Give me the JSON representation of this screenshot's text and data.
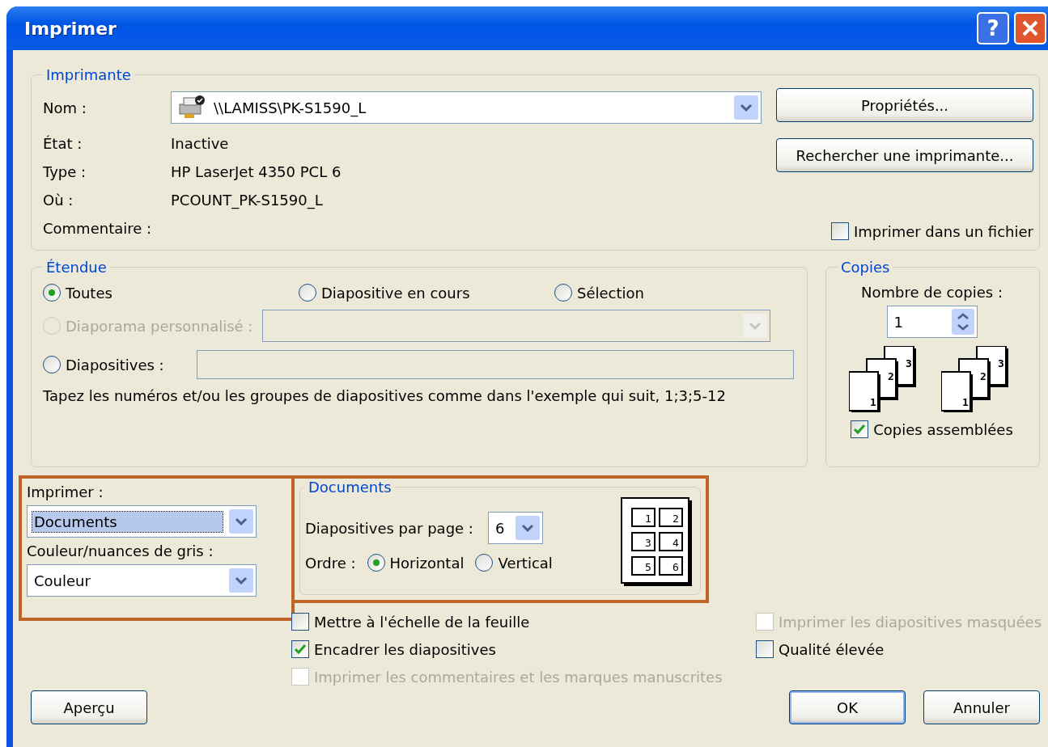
{
  "window": {
    "title": "Imprimer",
    "help_label": "?"
  },
  "printer": {
    "legend": "Imprimante",
    "name_label": "Nom :",
    "name_value": "\\\\LAMISS\\PK-S1590_L",
    "info": [
      {
        "label": "État :",
        "value": "Inactive"
      },
      {
        "label": "Type :",
        "value": "HP LaserJet 4350 PCL 6"
      },
      {
        "label": "Où :",
        "value": "PCOUNT_PK-S1590_L"
      },
      {
        "label": "Commentaire :"
      }
    ],
    "buttons": [
      "Propriétés...",
      "Rechercher une imprimante..."
    ],
    "print_to_file": {
      "label": "Imprimer dans un fichier",
      "checked": false
    }
  },
  "range": {
    "legend": "Étendue",
    "options": [
      {
        "label": "Toutes",
        "selected": true
      },
      {
        "label": "Diapositive en cours",
        "selected": false
      },
      {
        "label": "Sélection",
        "selected": false
      }
    ],
    "custom_show": {
      "label": "Diaporama personnalisé :",
      "selected": false,
      "disabled": true
    },
    "slides": {
      "label": "Diapositives :",
      "selected": false
    },
    "hint": "Tapez les numéros et/ou les groupes de diapositives comme dans l'exemple qui suit, 1;3;5-12"
  },
  "copies": {
    "legend": "Copies",
    "count_label": "Nombre de copies :",
    "count": "1",
    "stacks": [
      [
        "1",
        "2",
        "3"
      ],
      [
        "1",
        "2",
        "3"
      ]
    ],
    "collate": {
      "label": "Copies assemblées",
      "checked": true
    }
  },
  "print_what": {
    "label": "Imprimer :",
    "value": "Documents"
  },
  "color_mode": {
    "label": "Couleur/nuances de gris :",
    "value": "Couleur"
  },
  "handouts": {
    "legend": "Documents",
    "per_page_label": "Diapositives par page :",
    "per_page": "6",
    "order_label": "Ordre :",
    "order": [
      {
        "label": "Horizontal",
        "selected": true
      },
      {
        "label": "Vertical",
        "selected": false
      }
    ],
    "preview_numbers": [
      "1",
      "2",
      "3",
      "4",
      "5",
      "6"
    ]
  },
  "options_left": [
    {
      "label": "Mettre à l'échelle de la feuille",
      "checked": false,
      "disabled": false
    },
    {
      "label": "Encadrer les diapositives",
      "checked": true,
      "disabled": false
    },
    {
      "label": "Imprimer les commentaires et les marques manuscrites",
      "checked": false,
      "disabled": true
    }
  ],
  "options_right": [
    {
      "label": "Imprimer les diapositives masquées",
      "checked": false,
      "disabled": true
    },
    {
      "label": "Qualité élevée",
      "checked": false,
      "disabled": false
    }
  ],
  "footer": {
    "preview": "Aperçu",
    "ok": "OK",
    "cancel": "Annuler"
  }
}
